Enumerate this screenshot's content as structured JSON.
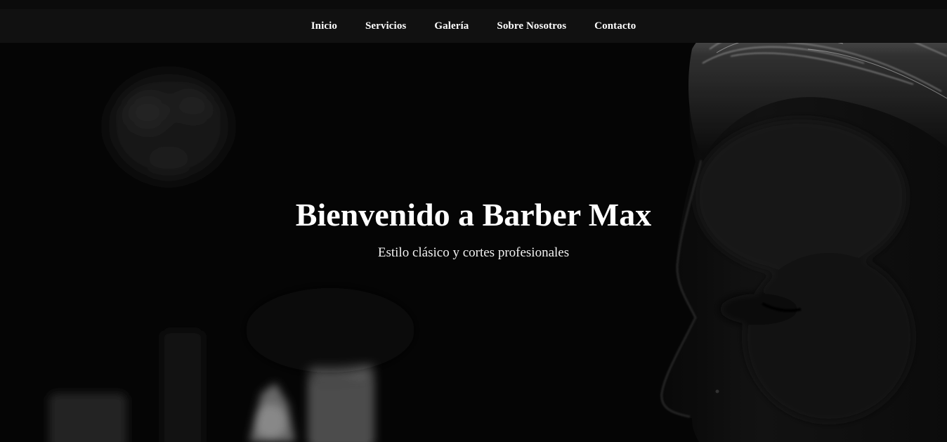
{
  "nav": {
    "items": [
      {
        "label": "Inicio"
      },
      {
        "label": "Servicios"
      },
      {
        "label": "Galería"
      },
      {
        "label": "Sobre Nosotros"
      },
      {
        "label": "Contacto"
      }
    ]
  },
  "hero": {
    "title": "Bienvenido a Barber Max",
    "subtitle": "Estilo clásico y cortes profesionales",
    "background": "black-and-white photo of a man's profile with a barbershop in the background"
  },
  "colors": {
    "navbar_bg": "#111111",
    "page_bg": "#050505",
    "text": "#ffffff"
  }
}
